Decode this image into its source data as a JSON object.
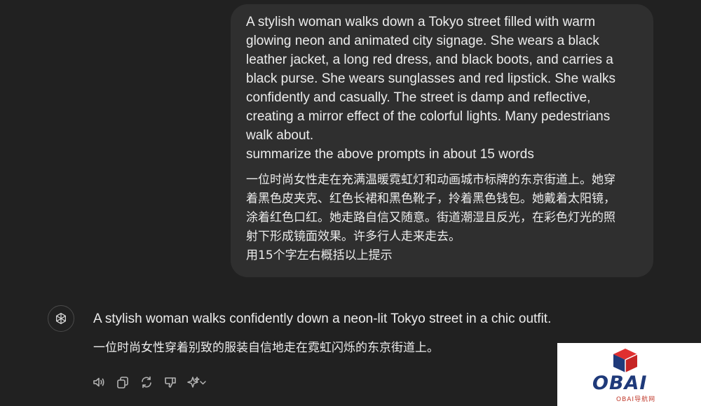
{
  "user_message": {
    "english": "A stylish woman walks down a Tokyo street filled with warm\nglowing neon and animated city signage. She wears a black\nleather jacket, a long red dress, and black boots, and carries a\nblack purse. She wears sunglasses and red lipstick. She walks\nconfidently and casually. The street is damp and reflective,\ncreating a mirror effect of the colorful lights. Many pedestrians\nwalk about.\nsummarize the above prompts in about 15 words",
    "chinese": "一位时尚女性走在充满温暖霓虹灯和动画城市标牌的东京街道上。她穿\n着黑色皮夹克、红色长裙和黑色靴子，拎着黑色钱包。她戴着太阳镜，\n涂着红色口红。她走路自信又随意。街道潮湿且反光，在彩色灯光的照\n射下形成镜面效果。许多行人走来走去。\n用15个字左右概括以上提示"
  },
  "assistant_message": {
    "avatar_icon": "openai-logo-icon",
    "english": "A stylish woman walks confidently down a neon-lit Tokyo street in a chic outfit.",
    "chinese": "一位时尚女性穿着别致的服装自信地走在霓虹闪烁的东京街道上。"
  },
  "actions": [
    {
      "name": "read-aloud",
      "icon": "speaker-icon"
    },
    {
      "name": "copy",
      "icon": "copy-icon"
    },
    {
      "name": "regenerate",
      "icon": "refresh-icon"
    },
    {
      "name": "bad-response",
      "icon": "thumbs-down-icon"
    },
    {
      "name": "switch-model",
      "icon": "sparkle-chevron-icon"
    }
  ],
  "watermark": {
    "logo_text": "OBAI",
    "sub_text": "OBAI导航网",
    "colors": {
      "navy": "#1f3a7a",
      "red": "#d62b2b"
    }
  },
  "colors": {
    "background": "#212121",
    "bubble": "#2f2f2f",
    "text": "#ececec",
    "icon": "#b4b4b4"
  }
}
